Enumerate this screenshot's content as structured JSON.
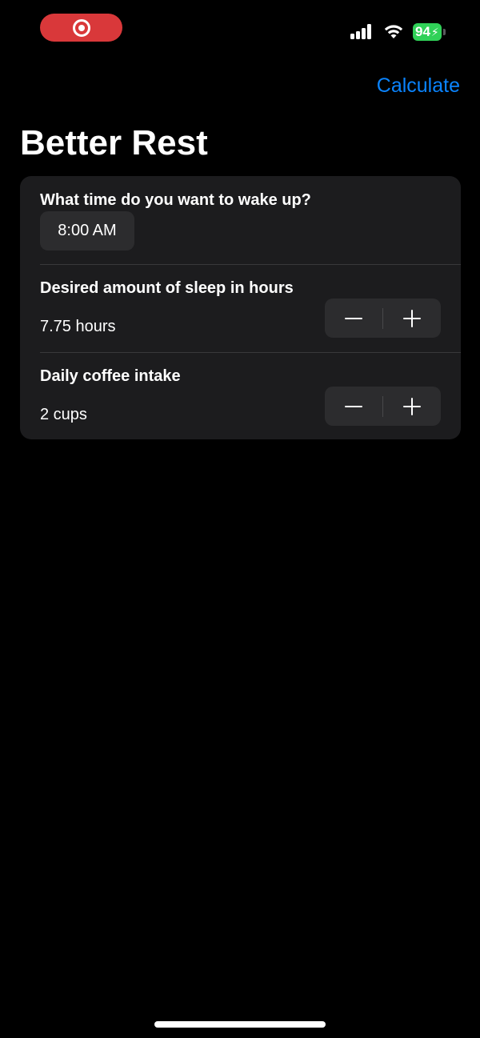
{
  "status_bar": {
    "recording_indicator_color": "#d9383a",
    "battery_level": "94",
    "battery_color": "#30d158",
    "signal_bars": 4,
    "icons": [
      "record-icon",
      "signal-icon",
      "wifi-icon",
      "battery-icon",
      "bolt-icon"
    ]
  },
  "nav": {
    "calculate_label": "Calculate",
    "accent_color": "#0a84ff"
  },
  "page": {
    "title": "Better Rest"
  },
  "form": {
    "wake_up": {
      "label": "What time do you want to wake up?",
      "value": "8:00 AM"
    },
    "sleep": {
      "label": "Desired amount of sleep in hours",
      "value": "7.75 hours"
    },
    "coffee": {
      "label": "Daily coffee intake",
      "value": "2 cups"
    }
  },
  "colors": {
    "background": "#000000",
    "card": "#1c1c1e",
    "control": "#2c2c2e"
  }
}
